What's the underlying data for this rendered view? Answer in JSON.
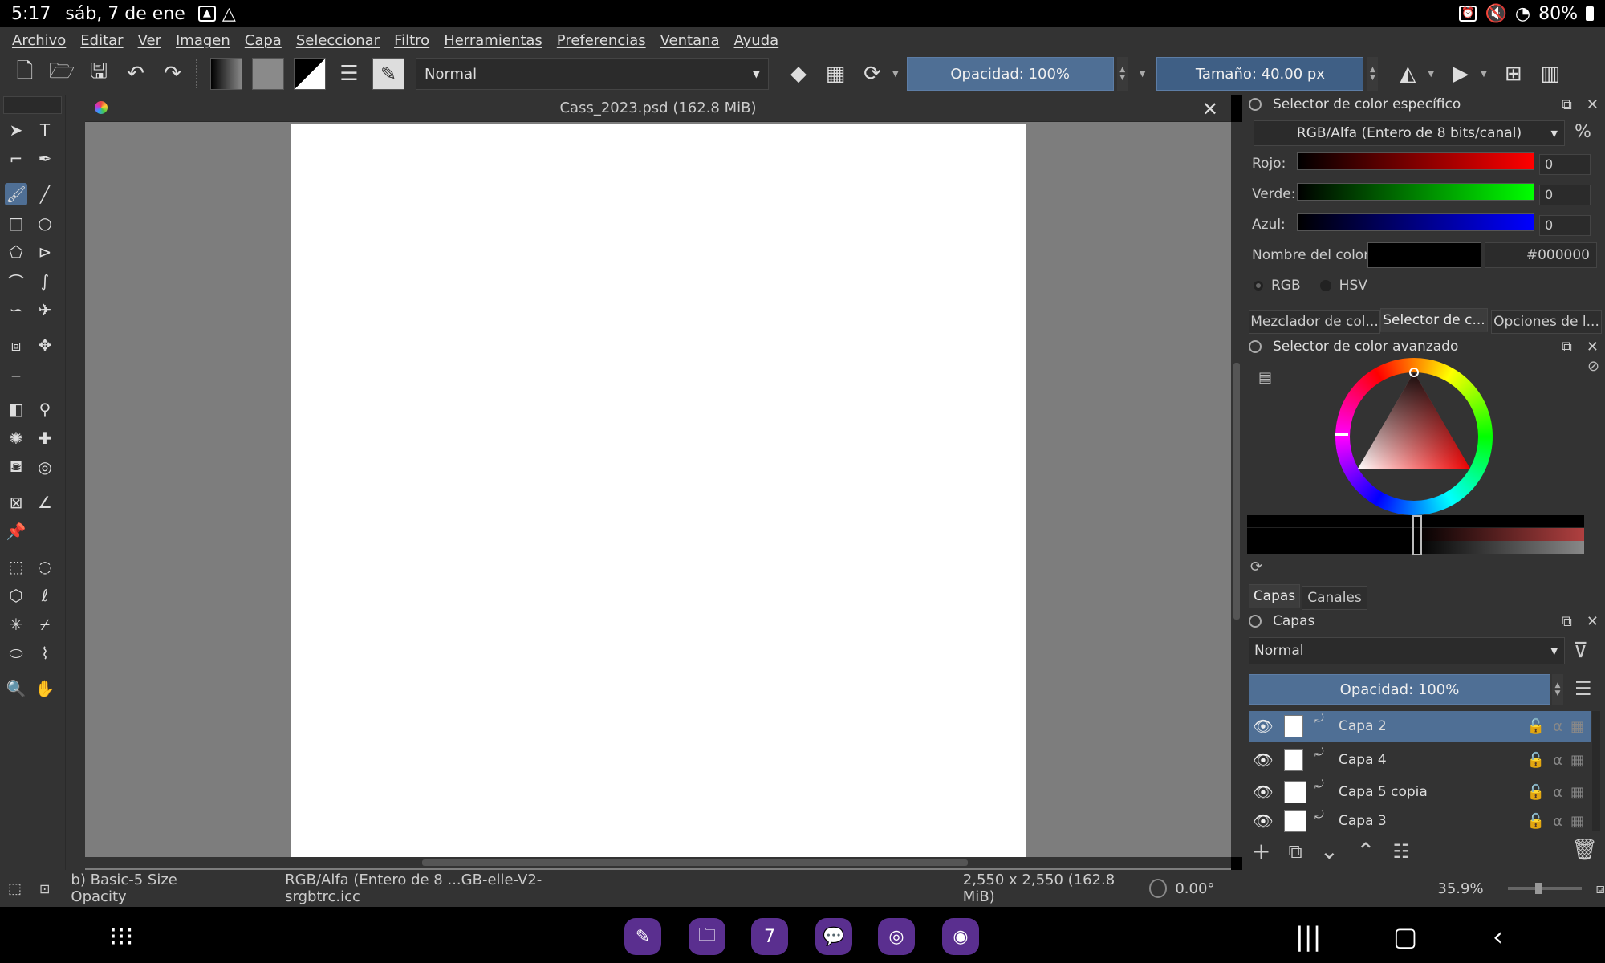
{
  "status_bar": {
    "time": "5:17",
    "date": "sáb, 7 de ene",
    "battery": "80%"
  },
  "menu": [
    "Archivo",
    "Editar",
    "Ver",
    "Imagen",
    "Capa",
    "Seleccionar",
    "Filtro",
    "Herramientas",
    "Preferencias",
    "Ventana",
    "Ayuda"
  ],
  "toolbar": {
    "blend_mode": "Normal",
    "opacity": "Opacidad: 100%",
    "size": "Tamaño: 40.00 px"
  },
  "document": {
    "title": "Cass_2023.psd (162.8 MiB)"
  },
  "specific_color_selector": {
    "title": "Selector de color específico",
    "color_model": "RGB/Alfa (Entero de 8 bits/canal)",
    "percent_symbol": "%",
    "channels": [
      {
        "label": "Rojo:",
        "value": "0",
        "color": "#ff0000"
      },
      {
        "label": "Verde:",
        "value": "0",
        "color": "#00ff00"
      },
      {
        "label": "Azul:",
        "value": "0",
        "color": "#0000ff"
      }
    ],
    "color_name_label": "Nombre del color:",
    "hex": "#000000",
    "modes": [
      "RGB",
      "HSV"
    ]
  },
  "docker_tabs": [
    "Mezclador de col...",
    "Selector de c...",
    "Opciones de l..."
  ],
  "advanced_color_selector": {
    "title": "Selector de color avanzado"
  },
  "layer_tabs": [
    "Capas",
    "Canales"
  ],
  "layers_panel": {
    "title": "Capas",
    "blend_mode": "Normal",
    "opacity": "Opacidad:  100%",
    "layers": [
      {
        "name": "Capa 2",
        "selected": true
      },
      {
        "name": "Capa 4",
        "selected": false
      },
      {
        "name": "Capa 5 copia",
        "selected": false
      },
      {
        "name": "Capa 3",
        "selected": false
      }
    ]
  },
  "bottom_bar": {
    "brush": "b) Basic-5 Size Opacity",
    "color_profile": "RGB/Alfa (Entero de 8 ...GB-elle-V2-srgbtrc.icc",
    "dimensions": "2,550 x 2,550 (162.8 MiB)",
    "rotation": "0.00°",
    "zoom": "35.9%"
  },
  "colors": {
    "accent": "#4f6f95",
    "panel": "#333333",
    "canvas_bg": "#7d7d7d"
  }
}
